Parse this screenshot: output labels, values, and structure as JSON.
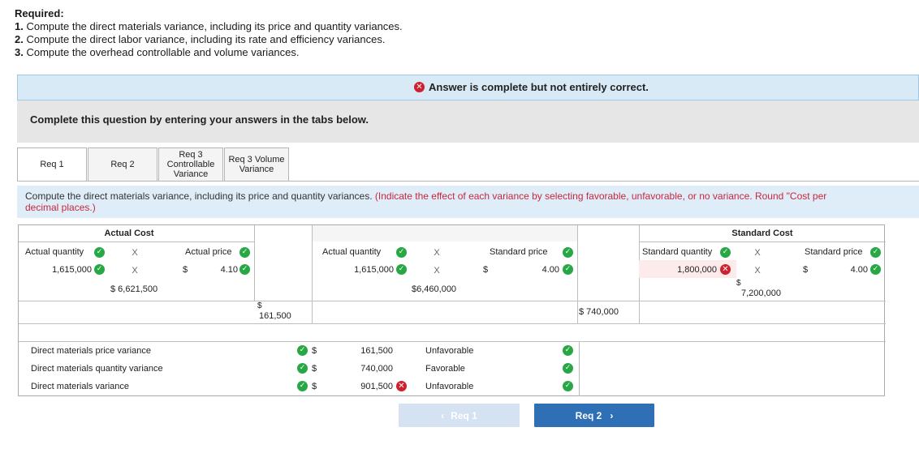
{
  "required": {
    "title": "Required:",
    "items": [
      {
        "num": "1.",
        "text": "Compute the direct materials variance, including its price and quantity variances."
      },
      {
        "num": "2.",
        "text": "Compute the direct labor variance, including its rate and efficiency variances."
      },
      {
        "num": "3.",
        "text": "Compute the overhead controllable and volume variances."
      }
    ]
  },
  "banner": {
    "text": "Answer is complete but not entirely correct.",
    "icon": "x-circle-icon",
    "color": "#d0202e"
  },
  "complete_text": "Complete this question by entering your answers in the tabs below.",
  "tabs": [
    {
      "label": "Req 1",
      "active": true
    },
    {
      "label": "Req 2",
      "active": false
    },
    {
      "label": "Req 3 Controllable Variance",
      "active": false
    },
    {
      "label": "Req 3 Volume Variance",
      "active": false
    }
  ],
  "instruction": {
    "main": "Compute the direct materials variance, including its price and quantity variances.",
    "note": "(Indicate the effect of each variance by selecting favorable, unfavorable, or no variance. Round \"Cost per",
    "note2": "decimal places.)"
  },
  "table": {
    "actual_cost_header": "Actual Cost",
    "standard_cost_header": "Standard Cost",
    "actual": {
      "qty_label": "Actual quantity",
      "x1": "X",
      "price_label": "Actual price",
      "qty_value": "1,615,000",
      "x2": "X",
      "dollar": "$",
      "price_value": "4.10",
      "total": "$ 6,621,500"
    },
    "mid": {
      "qty_label": "Actual quantity",
      "x1": "X",
      "price_label": "Standard price",
      "qty_value": "1,615,000",
      "x2": "X",
      "dollar": "$",
      "price_value": "4.00",
      "total": "$6,460,000"
    },
    "standard": {
      "qty_label": "Standard quantity",
      "x1": "X",
      "price_label": "Standard price",
      "qty_value": "1,800,000",
      "x2": "X",
      "dollar": "$",
      "price_value": "4.00",
      "total_dollar": "$",
      "total": "7,200,000"
    },
    "price_diff": {
      "dollar": "$",
      "value": "161,500"
    },
    "qty_diff": "$ 740,000",
    "variances": [
      {
        "label": "Direct materials price variance",
        "dollar": "$",
        "amount": "161,500",
        "effect": "Unfavorable",
        "amount_correct": true
      },
      {
        "label": "Direct materials quantity variance",
        "dollar": "$",
        "amount": "740,000",
        "effect": "Favorable",
        "amount_correct": true
      },
      {
        "label": "Direct materials variance",
        "dollar": "$",
        "amount": "901,500",
        "effect": "Unfavorable",
        "amount_correct": false
      }
    ]
  },
  "nav": {
    "prev": "Req 1",
    "next": "Req 2"
  }
}
